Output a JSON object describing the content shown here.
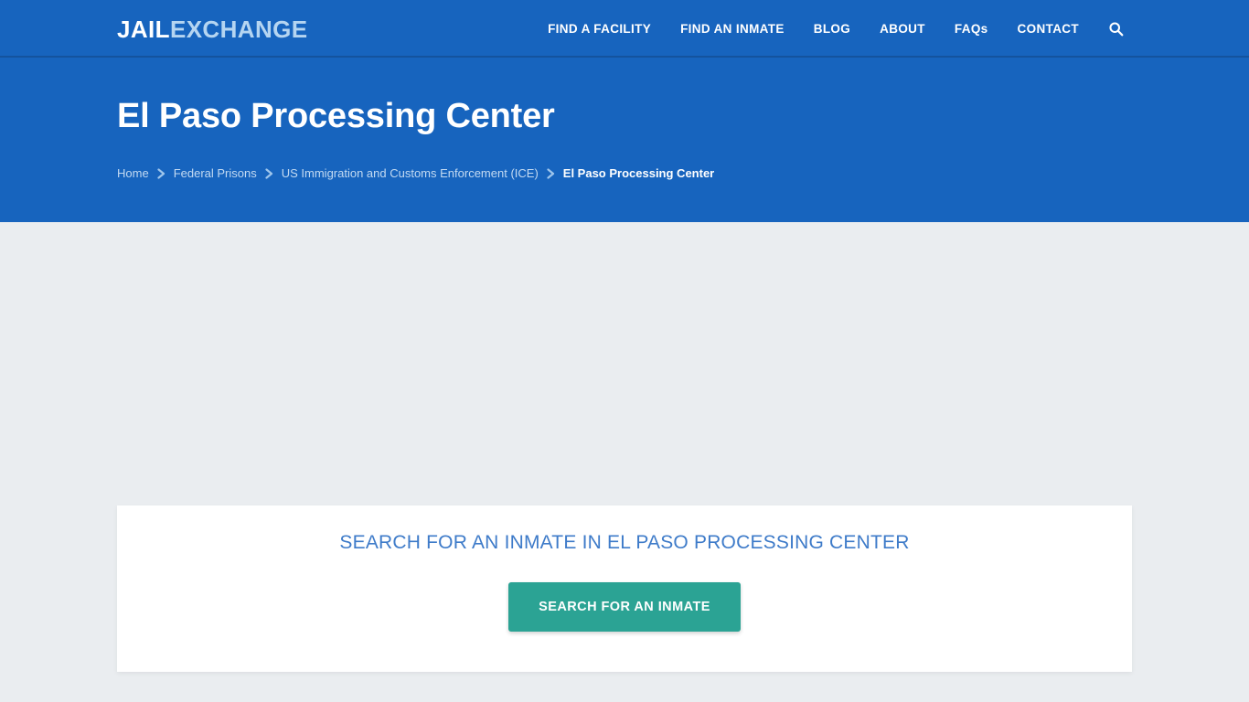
{
  "colors": {
    "brand_blue": "#1764be",
    "brand_blue_dark": "#14539e",
    "logo_accent": "#b5d5f1",
    "page_background": "#eaedf0",
    "heading_blue": "#3e7bc9",
    "cta_teal": "#2ba394",
    "breadcrumb_link": "#c3daf2",
    "card_white": "#ffffff"
  },
  "header": {
    "logo": {
      "primary": "JAIL",
      "secondary": "EXCHANGE"
    },
    "nav": [
      {
        "label": "FIND A FACILITY",
        "name": "nav-find-a-facility"
      },
      {
        "label": "FIND AN INMATE",
        "name": "nav-find-an-inmate"
      },
      {
        "label": "BLOG",
        "name": "nav-blog"
      },
      {
        "label": "ABOUT",
        "name": "nav-about"
      },
      {
        "label": "FAQs",
        "name": "nav-faqs"
      },
      {
        "label": "CONTACT",
        "name": "nav-contact"
      }
    ],
    "search_icon": "search-icon"
  },
  "hero": {
    "title": "El Paso Processing Center",
    "breadcrumb": [
      {
        "label": "Home",
        "current": false
      },
      {
        "label": "Federal Prisons",
        "current": false
      },
      {
        "label": "US Immigration and Customs Enforcement (ICE)",
        "current": false
      },
      {
        "label": "El Paso Processing Center",
        "current": true
      }
    ],
    "breadcrumb_separator_icon": "chevron-right-icon"
  },
  "main": {
    "search_card": {
      "heading": "SEARCH FOR AN INMATE IN EL PASO PROCESSING CENTER",
      "cta_label": "SEARCH FOR AN INMATE"
    }
  }
}
